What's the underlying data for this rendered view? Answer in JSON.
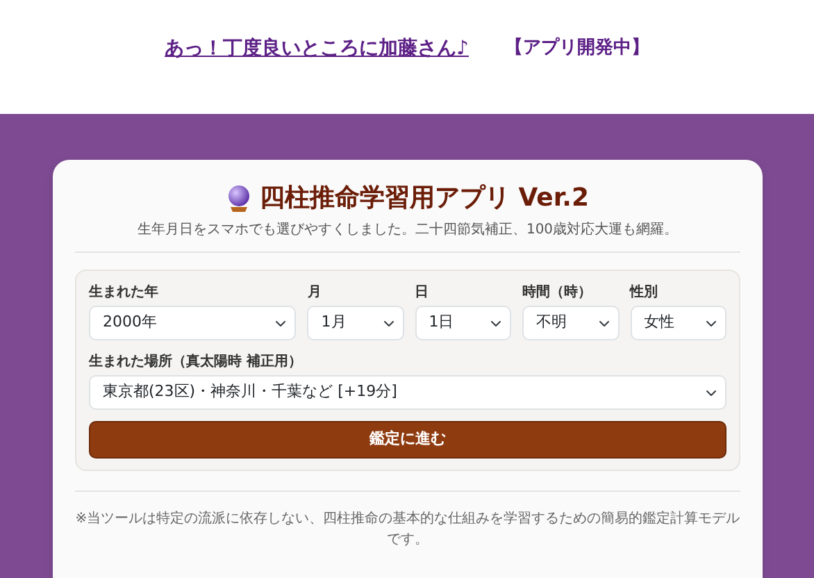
{
  "header": {
    "link": "あっ！丁度良いところに加藤さん♪",
    "tag": "【アプリ開発中】"
  },
  "card": {
    "title": "四柱推命学習用アプリ Ver.2",
    "subtitle": "生年月日をスマホでも選びやすくしました。二十四節気補正、100歳対応大運も網羅。",
    "form": {
      "fields": [
        {
          "label": "生まれた年",
          "value": "2000年"
        },
        {
          "label": "月",
          "value": "1月"
        },
        {
          "label": "日",
          "value": "1日"
        },
        {
          "label": "時間（時）",
          "value": "不明"
        },
        {
          "label": "性別",
          "value": "女性"
        }
      ],
      "place": {
        "label": "生まれた場所（真太陽時 補正用）",
        "value": "東京都(23区)・神奈川・千葉など [+19分]"
      },
      "submit": "鑑定に進む"
    },
    "note": "※当ツールは特定の流派に依存しない、四柱推命の基本的な仕組みを学習するための簡易的鑑定計算モデルです。"
  }
}
